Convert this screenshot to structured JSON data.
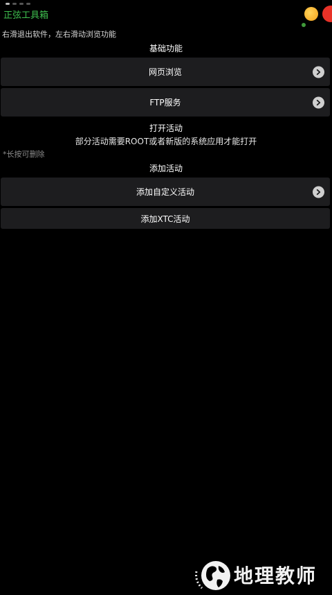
{
  "app": {
    "title": "正弦工具箱"
  },
  "hints": {
    "swipe": "右滑退出软件，左右滑动浏览功能",
    "long_press": "*长按可删除"
  },
  "sections": {
    "basic": {
      "title": "基础功能",
      "items": [
        {
          "label": "网页浏览",
          "icon": "chevron-right-icon"
        },
        {
          "label": "FTP服务",
          "icon": "chevron-right-icon"
        }
      ]
    },
    "open_activity": {
      "title": "打开活动",
      "subtitle": "部分活动需要ROOT或者新版的系统应用才能打开"
    },
    "add_activity": {
      "title": "添加活动",
      "items": [
        {
          "label": "添加自定义活动",
          "icon": "chevron-right-icon"
        },
        {
          "label": "添加XTC活动"
        }
      ]
    }
  },
  "watermark": {
    "text": "地理教师"
  },
  "colors": {
    "background": "#000000",
    "title_green": "#3fbf4f",
    "row_background": "#1d1d1f",
    "chevron_badge": "#cfcfcf"
  }
}
